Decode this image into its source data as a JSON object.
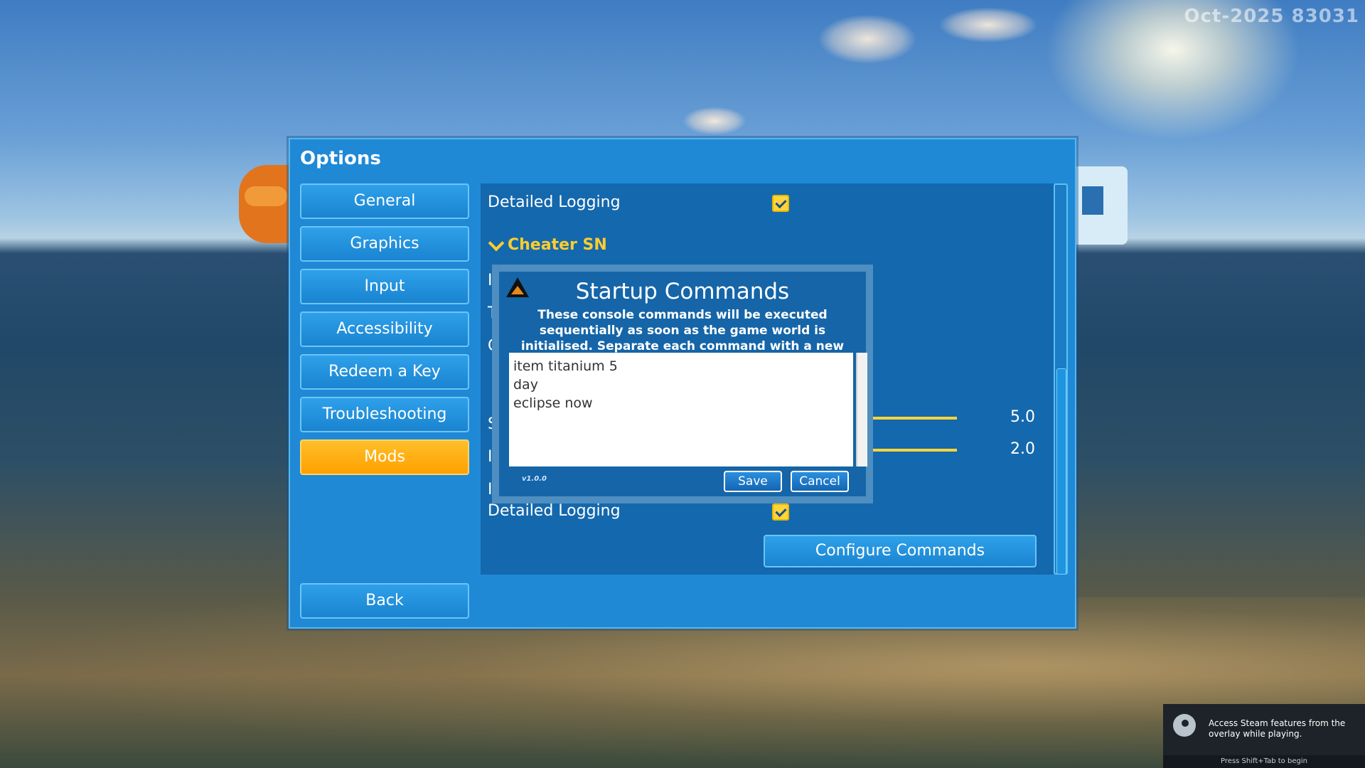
{
  "watermark": "Oct-2025 83031",
  "options": {
    "title": "Options",
    "nav": [
      "General",
      "Graphics",
      "Input",
      "Accessibility",
      "Redeem a Key",
      "Troubleshooting",
      "Mods"
    ],
    "active_nav": "Mods",
    "back_label": "Back"
  },
  "content": {
    "row1_label": "Detailed Logging",
    "section_title": "Cheater SN",
    "hidden_row_initials": [
      "I",
      "T",
      "C",
      "S",
      "I",
      "I"
    ],
    "slider1_value": "5.0",
    "slider2_value": "2.0",
    "row2_label": "Detailed Logging",
    "configure_label": "Configure Commands"
  },
  "dialog": {
    "title": "Startup Commands",
    "description": "These console commands will be executed sequentially as soon as the game world is initialised. Separate each command with a new line.",
    "commands": [
      "item titanium 5",
      "day",
      "eclipse now"
    ],
    "version": "v1.0.0",
    "save_label": "Save",
    "cancel_label": "Cancel"
  },
  "steam_overlay": {
    "text": "Access Steam features from the overlay while playing.",
    "hint": "Press Shift+Tab to begin"
  }
}
